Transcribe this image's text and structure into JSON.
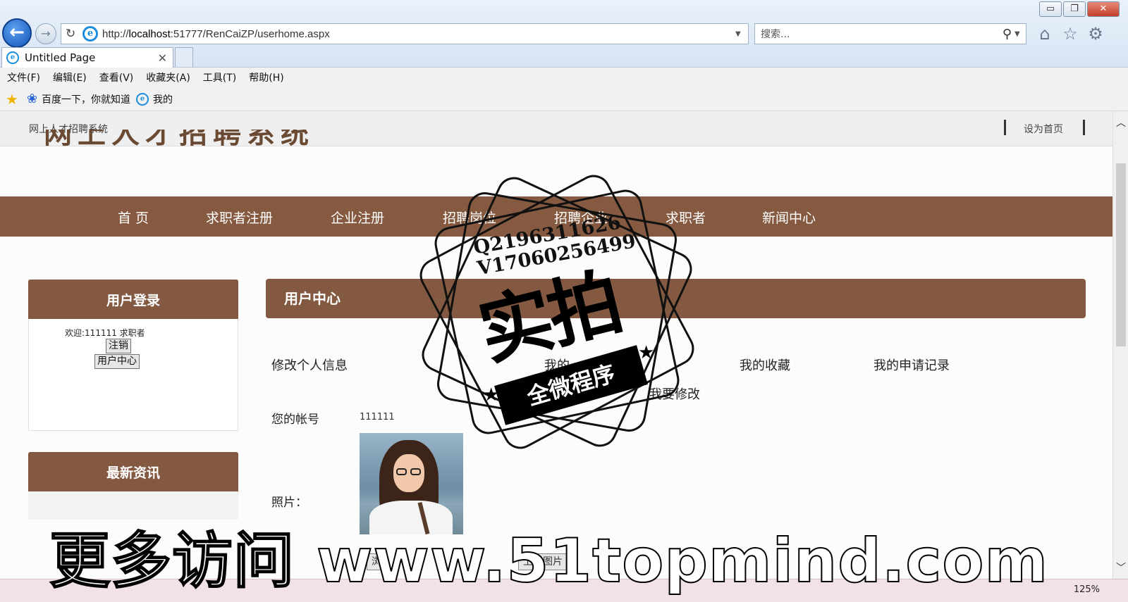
{
  "browser": {
    "url_prefix": "http://",
    "url_host": "localhost",
    "url_rest": ":51777/RenCaiZP/userhome.aspx",
    "search_placeholder": "搜索...",
    "tab_title": "Untitled Page",
    "window_buttons": {
      "minimize": "▭",
      "restore": "❐",
      "close": "✕"
    },
    "icons": {
      "back": "back-arrow-icon",
      "forward": "forward-arrow-icon",
      "refresh": "refresh-icon",
      "home": "home-icon",
      "favorites": "star-icon",
      "tools": "gear-icon"
    },
    "menu": [
      "文件(F)",
      "编辑(E)",
      "查看(V)",
      "收藏夹(A)",
      "工具(T)",
      "帮助(H)"
    ],
    "favorites": [
      "百度一下，你就知道",
      "我的"
    ],
    "zoom": "125%"
  },
  "site": {
    "top_name": "网上人才招聘系统",
    "logo_title": "网上人才招聘系统",
    "set_homepage": "设为首页",
    "nav": [
      "首 页",
      "求职者注册",
      "企业注册",
      "招聘岗位",
      "招聘企业",
      "求职者",
      "新闻中心"
    ]
  },
  "login_panel": {
    "title": "用户登录",
    "welcome": "欢迎:111111 求职者",
    "logout": "注销",
    "user_center": "用户中心"
  },
  "news_panel": {
    "title": "最新资讯"
  },
  "user_center": {
    "title": "用户中心",
    "links": [
      "修改个人信息",
      "我的",
      "我的收藏",
      "我的申请记录"
    ],
    "edit_link": "我要修改",
    "account_label": "您的帐号",
    "account_value": "111111",
    "photo_label": "照片：",
    "browse_label": "浏",
    "upload_label": "上传图片"
  },
  "watermark": {
    "qq": "Q2196311626",
    "vx": "V17060256499",
    "big": "实拍",
    "ribbon": "全微程序",
    "bottom": "更多访问 www.51topmind.com"
  }
}
